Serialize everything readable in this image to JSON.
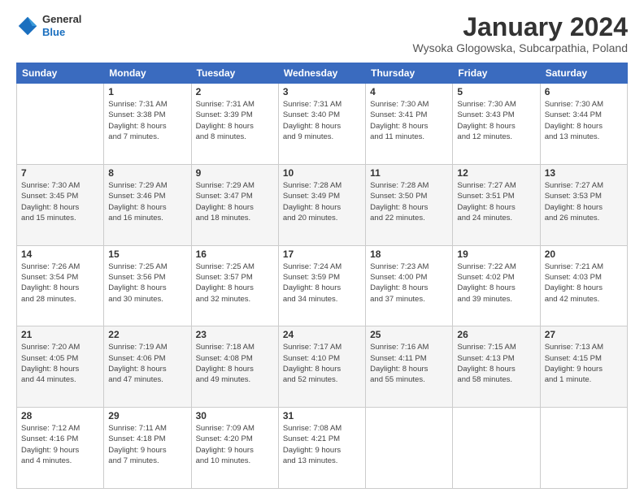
{
  "header": {
    "logo": {
      "general": "General",
      "blue": "Blue"
    },
    "title": "January 2024",
    "location": "Wysoka Glogowska, Subcarpathia, Poland"
  },
  "weekdays": [
    "Sunday",
    "Monday",
    "Tuesday",
    "Wednesday",
    "Thursday",
    "Friday",
    "Saturday"
  ],
  "weeks": [
    [
      {
        "day": "",
        "info": ""
      },
      {
        "day": "1",
        "info": "Sunrise: 7:31 AM\nSunset: 3:38 PM\nDaylight: 8 hours\nand 7 minutes."
      },
      {
        "day": "2",
        "info": "Sunrise: 7:31 AM\nSunset: 3:39 PM\nDaylight: 8 hours\nand 8 minutes."
      },
      {
        "day": "3",
        "info": "Sunrise: 7:31 AM\nSunset: 3:40 PM\nDaylight: 8 hours\nand 9 minutes."
      },
      {
        "day": "4",
        "info": "Sunrise: 7:30 AM\nSunset: 3:41 PM\nDaylight: 8 hours\nand 11 minutes."
      },
      {
        "day": "5",
        "info": "Sunrise: 7:30 AM\nSunset: 3:43 PM\nDaylight: 8 hours\nand 12 minutes."
      },
      {
        "day": "6",
        "info": "Sunrise: 7:30 AM\nSunset: 3:44 PM\nDaylight: 8 hours\nand 13 minutes."
      }
    ],
    [
      {
        "day": "7",
        "info": "Sunrise: 7:30 AM\nSunset: 3:45 PM\nDaylight: 8 hours\nand 15 minutes."
      },
      {
        "day": "8",
        "info": "Sunrise: 7:29 AM\nSunset: 3:46 PM\nDaylight: 8 hours\nand 16 minutes."
      },
      {
        "day": "9",
        "info": "Sunrise: 7:29 AM\nSunset: 3:47 PM\nDaylight: 8 hours\nand 18 minutes."
      },
      {
        "day": "10",
        "info": "Sunrise: 7:28 AM\nSunset: 3:49 PM\nDaylight: 8 hours\nand 20 minutes."
      },
      {
        "day": "11",
        "info": "Sunrise: 7:28 AM\nSunset: 3:50 PM\nDaylight: 8 hours\nand 22 minutes."
      },
      {
        "day": "12",
        "info": "Sunrise: 7:27 AM\nSunset: 3:51 PM\nDaylight: 8 hours\nand 24 minutes."
      },
      {
        "day": "13",
        "info": "Sunrise: 7:27 AM\nSunset: 3:53 PM\nDaylight: 8 hours\nand 26 minutes."
      }
    ],
    [
      {
        "day": "14",
        "info": "Sunrise: 7:26 AM\nSunset: 3:54 PM\nDaylight: 8 hours\nand 28 minutes."
      },
      {
        "day": "15",
        "info": "Sunrise: 7:25 AM\nSunset: 3:56 PM\nDaylight: 8 hours\nand 30 minutes."
      },
      {
        "day": "16",
        "info": "Sunrise: 7:25 AM\nSunset: 3:57 PM\nDaylight: 8 hours\nand 32 minutes."
      },
      {
        "day": "17",
        "info": "Sunrise: 7:24 AM\nSunset: 3:59 PM\nDaylight: 8 hours\nand 34 minutes."
      },
      {
        "day": "18",
        "info": "Sunrise: 7:23 AM\nSunset: 4:00 PM\nDaylight: 8 hours\nand 37 minutes."
      },
      {
        "day": "19",
        "info": "Sunrise: 7:22 AM\nSunset: 4:02 PM\nDaylight: 8 hours\nand 39 minutes."
      },
      {
        "day": "20",
        "info": "Sunrise: 7:21 AM\nSunset: 4:03 PM\nDaylight: 8 hours\nand 42 minutes."
      }
    ],
    [
      {
        "day": "21",
        "info": "Sunrise: 7:20 AM\nSunset: 4:05 PM\nDaylight: 8 hours\nand 44 minutes."
      },
      {
        "day": "22",
        "info": "Sunrise: 7:19 AM\nSunset: 4:06 PM\nDaylight: 8 hours\nand 47 minutes."
      },
      {
        "day": "23",
        "info": "Sunrise: 7:18 AM\nSunset: 4:08 PM\nDaylight: 8 hours\nand 49 minutes."
      },
      {
        "day": "24",
        "info": "Sunrise: 7:17 AM\nSunset: 4:10 PM\nDaylight: 8 hours\nand 52 minutes."
      },
      {
        "day": "25",
        "info": "Sunrise: 7:16 AM\nSunset: 4:11 PM\nDaylight: 8 hours\nand 55 minutes."
      },
      {
        "day": "26",
        "info": "Sunrise: 7:15 AM\nSunset: 4:13 PM\nDaylight: 8 hours\nand 58 minutes."
      },
      {
        "day": "27",
        "info": "Sunrise: 7:13 AM\nSunset: 4:15 PM\nDaylight: 9 hours\nand 1 minute."
      }
    ],
    [
      {
        "day": "28",
        "info": "Sunrise: 7:12 AM\nSunset: 4:16 PM\nDaylight: 9 hours\nand 4 minutes."
      },
      {
        "day": "29",
        "info": "Sunrise: 7:11 AM\nSunset: 4:18 PM\nDaylight: 9 hours\nand 7 minutes."
      },
      {
        "day": "30",
        "info": "Sunrise: 7:09 AM\nSunset: 4:20 PM\nDaylight: 9 hours\nand 10 minutes."
      },
      {
        "day": "31",
        "info": "Sunrise: 7:08 AM\nSunset: 4:21 PM\nDaylight: 9 hours\nand 13 minutes."
      },
      {
        "day": "",
        "info": ""
      },
      {
        "day": "",
        "info": ""
      },
      {
        "day": "",
        "info": ""
      }
    ]
  ]
}
